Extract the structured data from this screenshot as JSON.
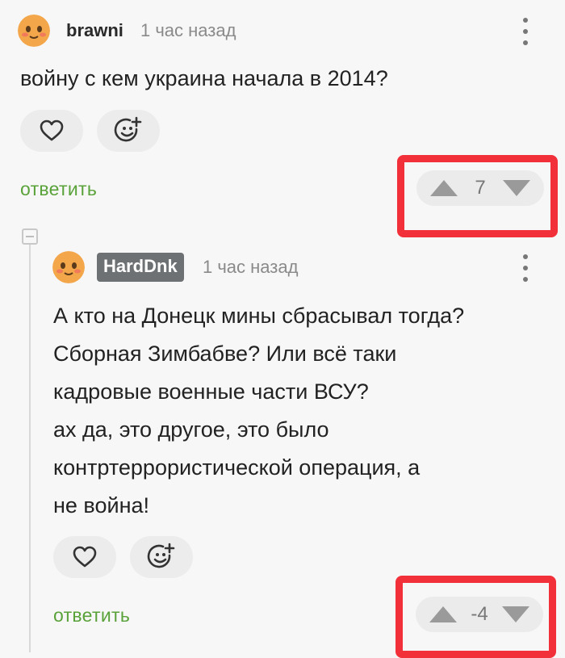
{
  "comment1": {
    "username": "brawni",
    "time": "1 час назад",
    "text": "войну с кем украина начала в 2014?",
    "reply_label": "ответить",
    "vote_count": "7",
    "icons": {
      "avatar": "avatar-emoji-icon",
      "menu": "kebab-menu-icon",
      "like": "heart-icon",
      "react": "emoji-add-icon",
      "upvote": "triangle-up-icon",
      "downvote": "triangle-down-icon"
    }
  },
  "comment2": {
    "username": "HardDnk",
    "time": "1 час назад",
    "text": "А кто на Донецк мины сбрасывал тогда?\nСборная Зимбабве? Или всё таки\nкадровые военные части ВСУ?\nах да, это другое, это было\nконтртеррористической операция, а\nне война!",
    "reply_label": "ответить",
    "vote_count": "-4",
    "icons": {
      "avatar": "avatar-emoji-icon",
      "menu": "kebab-menu-icon",
      "like": "heart-icon",
      "react": "emoji-add-icon",
      "upvote": "triangle-up-icon",
      "downvote": "triangle-down-icon"
    }
  },
  "colors": {
    "accent_green": "#5aa23a",
    "highlight_red": "#f2303a",
    "badge_gray": "#6e7174",
    "background": "#f7f7f7"
  }
}
